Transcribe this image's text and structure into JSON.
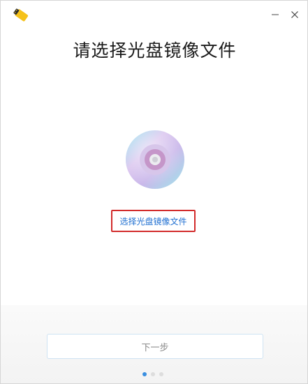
{
  "window": {
    "minimize_icon": "minimize-icon",
    "close_icon": "close-icon",
    "app_icon": "usb-drive-icon"
  },
  "main": {
    "title": "请选择光盘镜像文件",
    "disc_icon": "optical-disc-icon",
    "select_link": "选择光盘镜像文件"
  },
  "footer": {
    "next_label": "下一步",
    "steps_total": 3,
    "steps_current": 1
  },
  "colors": {
    "link": "#1f6fd1",
    "highlight_border": "#d22b2b",
    "active_dot": "#3a8fe0",
    "app_icon_yellow": "#f5c21b"
  }
}
